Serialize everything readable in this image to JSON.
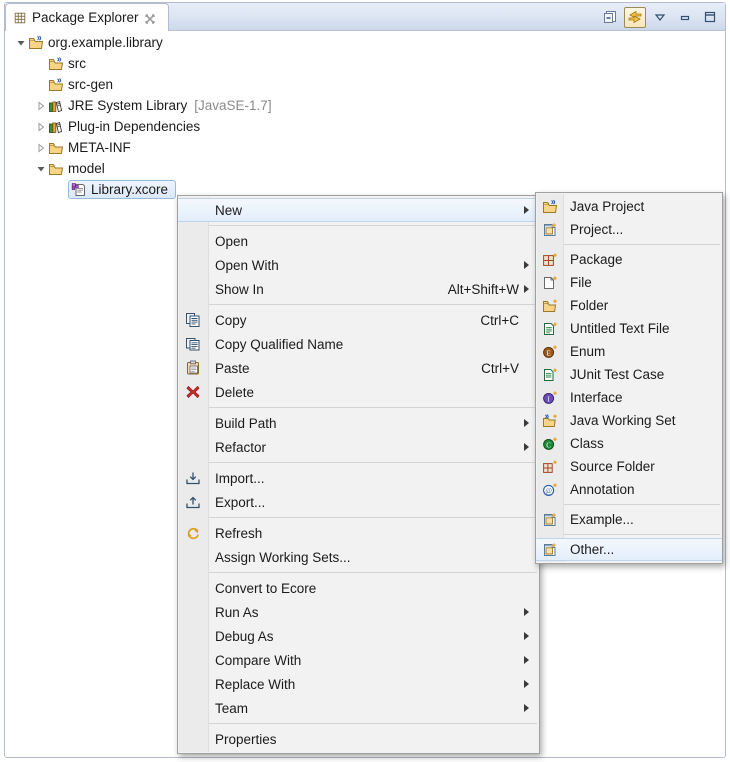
{
  "view": {
    "tab_label": "Package Explorer",
    "tab_icon": "package-explorer-icon",
    "close_icon": "close-icon",
    "toolbar": [
      {
        "name": "collapse-all-button",
        "icon": "collapse-all-icon",
        "toggled": false
      },
      {
        "name": "link-with-editor-button",
        "icon": "link-with-editor-icon",
        "toggled": true
      },
      {
        "name": "view-menu-button",
        "icon": "chevron-down-icon",
        "toggled": false
      },
      {
        "name": "minimize-button",
        "icon": "minimize-icon",
        "toggled": false
      },
      {
        "name": "maximize-button",
        "icon": "maximize-icon",
        "toggled": false
      }
    ]
  },
  "tree": [
    {
      "label": "org.example.library",
      "suffix": "",
      "icon": "java-project-icon",
      "twisty": "expanded",
      "indent": 0,
      "selected": false
    },
    {
      "label": "src",
      "suffix": "",
      "icon": "source-folder-icon",
      "twisty": "none",
      "indent": 1,
      "selected": false
    },
    {
      "label": "src-gen",
      "suffix": "",
      "icon": "source-folder-icon",
      "twisty": "none",
      "indent": 1,
      "selected": false
    },
    {
      "label": "JRE System Library",
      "suffix": "[JavaSE-1.7]",
      "icon": "library-icon",
      "twisty": "collapsed",
      "indent": 1,
      "selected": false
    },
    {
      "label": "Plug-in Dependencies",
      "suffix": "",
      "icon": "library-icon",
      "twisty": "collapsed",
      "indent": 1,
      "selected": false
    },
    {
      "label": "META-INF",
      "suffix": "",
      "icon": "folder-icon",
      "twisty": "collapsed",
      "indent": 1,
      "selected": false
    },
    {
      "label": "model",
      "suffix": "",
      "icon": "folder-icon",
      "twisty": "expanded",
      "indent": 1,
      "selected": false
    },
    {
      "label": "Library.xcore",
      "suffix": "",
      "icon": "xcore-file-icon",
      "twisty": "none",
      "indent": 2,
      "selected": true
    }
  ],
  "context_menu": [
    {
      "type": "item",
      "label": "New",
      "accel": "",
      "icon": "",
      "arrow": true,
      "highlight": true,
      "name": "menu-item-new"
    },
    {
      "type": "sep"
    },
    {
      "type": "item",
      "label": "Open",
      "accel": "",
      "icon": "",
      "arrow": false,
      "highlight": false,
      "name": "menu-item-open"
    },
    {
      "type": "item",
      "label": "Open With",
      "accel": "",
      "icon": "",
      "arrow": true,
      "highlight": false,
      "name": "menu-item-open-with"
    },
    {
      "type": "item",
      "label": "Show In",
      "accel": "Alt+Shift+W",
      "icon": "",
      "arrow": true,
      "highlight": false,
      "name": "menu-item-show-in"
    },
    {
      "type": "sep"
    },
    {
      "type": "item",
      "label": "Copy",
      "accel": "Ctrl+C",
      "icon": "copy-icon",
      "arrow": false,
      "highlight": false,
      "name": "menu-item-copy"
    },
    {
      "type": "item",
      "label": "Copy Qualified Name",
      "accel": "",
      "icon": "copy-qualified-icon",
      "arrow": false,
      "highlight": false,
      "name": "menu-item-copy-qualified-name"
    },
    {
      "type": "item",
      "label": "Paste",
      "accel": "Ctrl+V",
      "icon": "paste-icon",
      "arrow": false,
      "highlight": false,
      "name": "menu-item-paste"
    },
    {
      "type": "item",
      "label": "Delete",
      "accel": "",
      "icon": "delete-icon",
      "arrow": false,
      "highlight": false,
      "name": "menu-item-delete"
    },
    {
      "type": "sep"
    },
    {
      "type": "item",
      "label": "Build Path",
      "accel": "",
      "icon": "",
      "arrow": true,
      "highlight": false,
      "name": "menu-item-build-path"
    },
    {
      "type": "item",
      "label": "Refactor",
      "accel": "",
      "icon": "",
      "arrow": true,
      "highlight": false,
      "name": "menu-item-refactor"
    },
    {
      "type": "sep"
    },
    {
      "type": "item",
      "label": "Import...",
      "accel": "",
      "icon": "import-icon",
      "arrow": false,
      "highlight": false,
      "name": "menu-item-import"
    },
    {
      "type": "item",
      "label": "Export...",
      "accel": "",
      "icon": "export-icon",
      "arrow": false,
      "highlight": false,
      "name": "menu-item-export"
    },
    {
      "type": "sep"
    },
    {
      "type": "item",
      "label": "Refresh",
      "accel": "",
      "icon": "refresh-icon",
      "arrow": false,
      "highlight": false,
      "name": "menu-item-refresh"
    },
    {
      "type": "item",
      "label": "Assign Working Sets...",
      "accel": "",
      "icon": "",
      "arrow": false,
      "highlight": false,
      "name": "menu-item-assign-working-sets"
    },
    {
      "type": "sep"
    },
    {
      "type": "item",
      "label": "Convert to Ecore",
      "accel": "",
      "icon": "",
      "arrow": false,
      "highlight": false,
      "name": "menu-item-convert-to-ecore"
    },
    {
      "type": "item",
      "label": "Run As",
      "accel": "",
      "icon": "",
      "arrow": true,
      "highlight": false,
      "name": "menu-item-run-as"
    },
    {
      "type": "item",
      "label": "Debug As",
      "accel": "",
      "icon": "",
      "arrow": true,
      "highlight": false,
      "name": "menu-item-debug-as"
    },
    {
      "type": "item",
      "label": "Compare With",
      "accel": "",
      "icon": "",
      "arrow": true,
      "highlight": false,
      "name": "menu-item-compare-with"
    },
    {
      "type": "item",
      "label": "Replace With",
      "accel": "",
      "icon": "",
      "arrow": true,
      "highlight": false,
      "name": "menu-item-replace-with"
    },
    {
      "type": "item",
      "label": "Team",
      "accel": "",
      "icon": "",
      "arrow": true,
      "highlight": false,
      "name": "menu-item-team"
    },
    {
      "type": "sep"
    },
    {
      "type": "item",
      "label": "Properties",
      "accel": "",
      "icon": "",
      "arrow": false,
      "highlight": false,
      "name": "menu-item-properties"
    }
  ],
  "new_submenu": [
    {
      "type": "item",
      "label": "Java Project",
      "icon": "java-project-icon",
      "highlight": false,
      "name": "menu-item-java-project"
    },
    {
      "type": "item",
      "label": "Project...",
      "icon": "project-icon",
      "highlight": false,
      "name": "menu-item-project"
    },
    {
      "type": "sep"
    },
    {
      "type": "item",
      "label": "Package",
      "icon": "package-icon",
      "highlight": false,
      "name": "menu-item-package"
    },
    {
      "type": "item",
      "label": "File",
      "icon": "file-icon",
      "highlight": false,
      "name": "menu-item-file"
    },
    {
      "type": "item",
      "label": "Folder",
      "icon": "folder-new-icon",
      "highlight": false,
      "name": "menu-item-folder"
    },
    {
      "type": "item",
      "label": "Untitled Text File",
      "icon": "text-file-icon",
      "highlight": false,
      "name": "menu-item-untitled-text-file"
    },
    {
      "type": "item",
      "label": "Enum",
      "icon": "enum-icon",
      "highlight": false,
      "name": "menu-item-enum"
    },
    {
      "type": "item",
      "label": "JUnit Test Case",
      "icon": "junit-test-icon",
      "highlight": false,
      "name": "menu-item-junit-test-case"
    },
    {
      "type": "item",
      "label": "Interface",
      "icon": "interface-icon",
      "highlight": false,
      "name": "menu-item-interface"
    },
    {
      "type": "item",
      "label": "Java Working Set",
      "icon": "working-set-icon",
      "highlight": false,
      "name": "menu-item-java-working-set"
    },
    {
      "type": "item",
      "label": "Class",
      "icon": "class-icon",
      "highlight": false,
      "name": "menu-item-class"
    },
    {
      "type": "item",
      "label": "Source Folder",
      "icon": "source-folder-new-icon",
      "highlight": false,
      "name": "menu-item-source-folder"
    },
    {
      "type": "item",
      "label": "Annotation",
      "icon": "annotation-icon",
      "highlight": false,
      "name": "menu-item-annotation"
    },
    {
      "type": "sep"
    },
    {
      "type": "item",
      "label": "Example...",
      "icon": "project-icon",
      "highlight": false,
      "name": "menu-item-example"
    },
    {
      "type": "sep"
    },
    {
      "type": "item",
      "label": "Other...",
      "icon": "project-icon",
      "highlight": true,
      "name": "menu-item-other"
    }
  ],
  "colors": {
    "menu_bg": "#f2f2f2",
    "highlight": "#e3eefb",
    "highlight_border": "#bcd4ee",
    "selection_border": "#96b9de",
    "suffix_text": "#8a8a8a"
  }
}
